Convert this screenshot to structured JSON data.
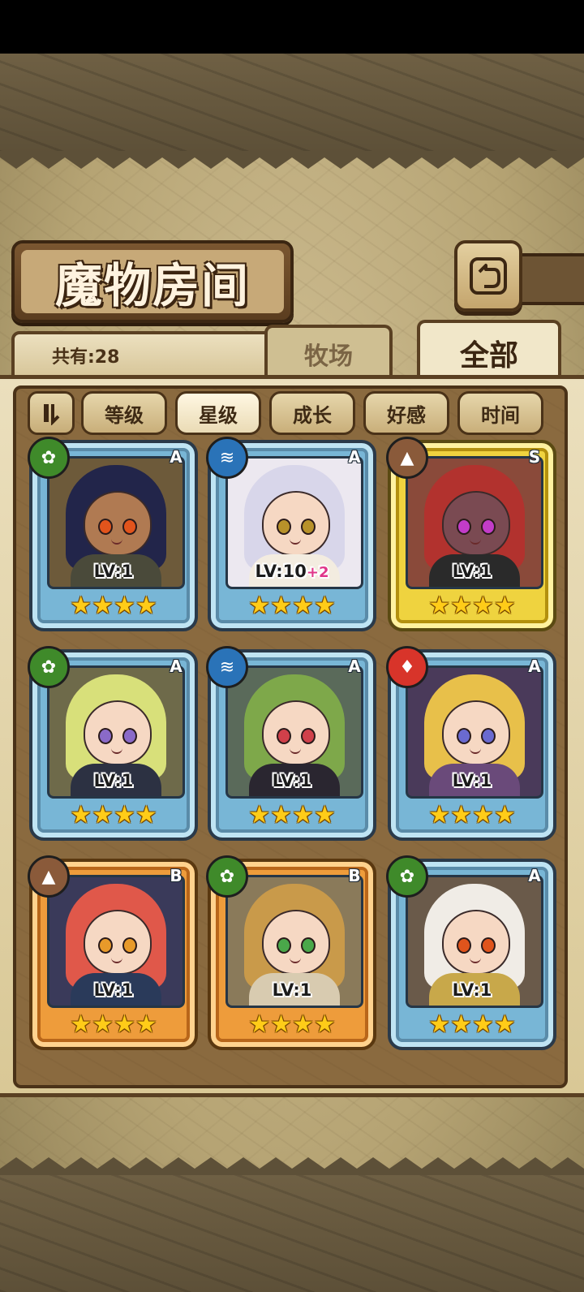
{
  "title": "魔物房间",
  "count_label": "共有:28",
  "tabs": {
    "farm": "牧场",
    "all": "全部"
  },
  "sort_buttons": [
    "等级",
    "星级",
    "成长",
    "好感",
    "时间"
  ],
  "active_sort": "星级",
  "colors": {
    "panel": "#8a6a3f",
    "accent": "#ffcc18",
    "text_dark": "#3b2612"
  },
  "monsters": [
    {
      "level": "LV:1",
      "bonus": "",
      "stars": "★★★★",
      "rank": "A",
      "element": "grass-icon",
      "frame": "blue"
    },
    {
      "level": "LV:10",
      "bonus": "+2",
      "stars": "★★★★",
      "rank": "A",
      "element": "water-icon",
      "frame": "blue"
    },
    {
      "level": "LV:1",
      "bonus": "",
      "stars": "★★★★",
      "rank": "S",
      "element": "earth-icon",
      "frame": "gold"
    },
    {
      "level": "LV:1",
      "bonus": "",
      "stars": "★★★★",
      "rank": "A",
      "element": "grass-icon",
      "frame": "blue"
    },
    {
      "level": "LV:1",
      "bonus": "",
      "stars": "★★★★",
      "rank": "A",
      "element": "water-icon",
      "frame": "blue"
    },
    {
      "level": "LV:1",
      "bonus": "",
      "stars": "★★★★",
      "rank": "A",
      "element": "fire-icon",
      "frame": "blue"
    },
    {
      "level": "LV:1",
      "bonus": "",
      "stars": "★★★★",
      "rank": "B",
      "element": "earth-icon",
      "frame": "orange"
    },
    {
      "level": "LV:1",
      "bonus": "",
      "stars": "★★★★",
      "rank": "B",
      "element": "grass-icon",
      "frame": "orange"
    },
    {
      "level": "LV:1",
      "bonus": "",
      "stars": "★★★★",
      "rank": "A",
      "element": "grass-icon",
      "frame": "blue"
    }
  ]
}
